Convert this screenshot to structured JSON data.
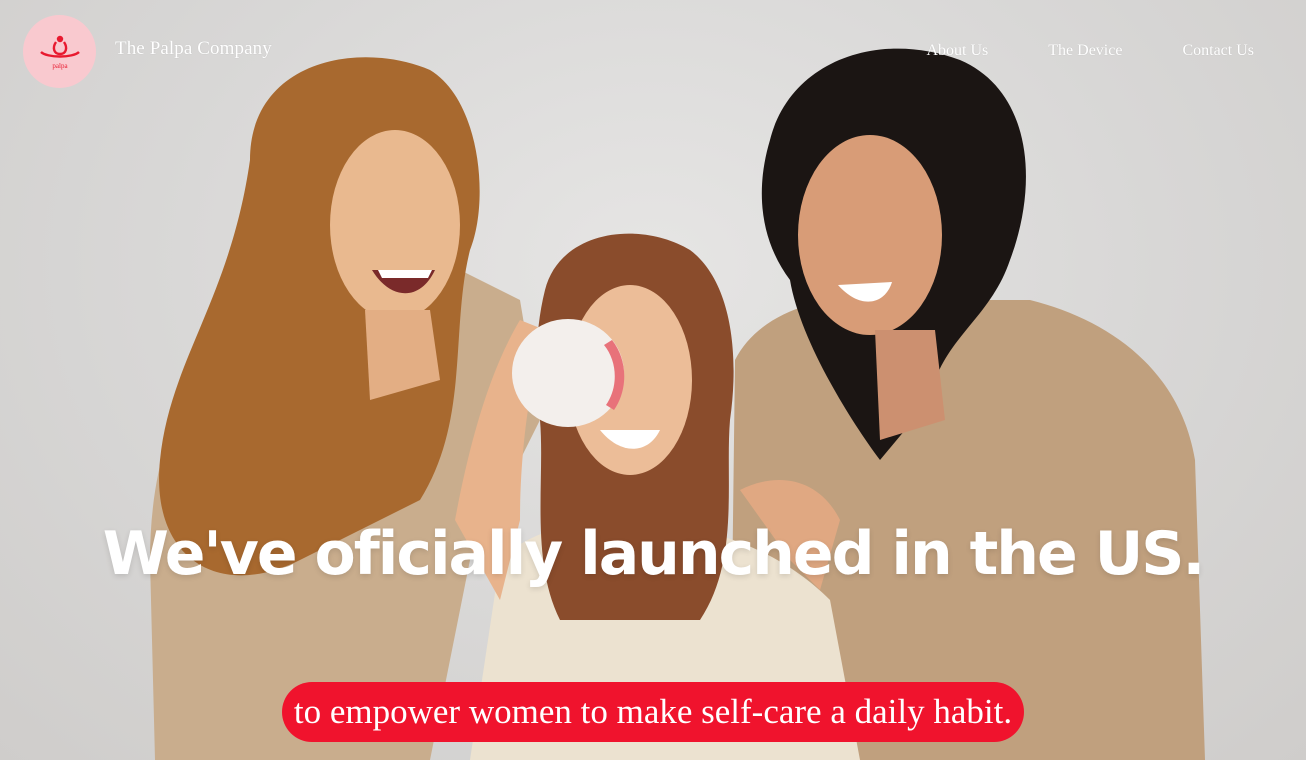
{
  "header": {
    "logo_text": "palpa",
    "brand_name": "The Palpa Company"
  },
  "nav": {
    "items": [
      {
        "label": "About Us"
      },
      {
        "label": "The Device"
      },
      {
        "label": "Contact Us"
      }
    ]
  },
  "hero": {
    "headline": "We've oficially launched in the US.",
    "tagline": "to empower women to make self-care a daily habit."
  },
  "colors": {
    "brand_red": "#f0132d",
    "logo_pink": "#f9c9cf",
    "robe_beige": "#c9ad8d",
    "background_gray": "#d9d8d7"
  }
}
